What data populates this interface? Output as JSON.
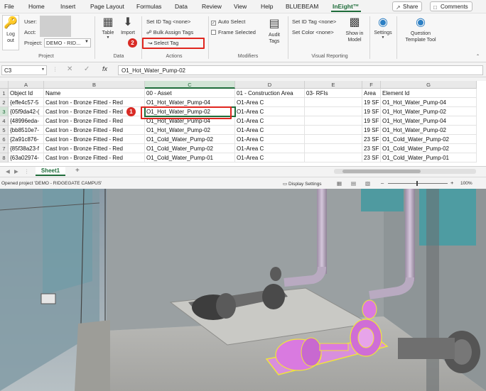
{
  "menu": {
    "file": "File",
    "home": "Home",
    "insert": "Insert",
    "page_layout": "Page Layout",
    "formulas": "Formulas",
    "data": "Data",
    "review": "Review",
    "view": "View",
    "help": "Help",
    "bluebeam": "BLUEBEAM",
    "ineight": "InEight™",
    "share": "Share",
    "comments": "Comments"
  },
  "ribbon": {
    "project": {
      "logout": "Log\nout",
      "user": "User:",
      "account": "Acct:",
      "project": "Project:",
      "project_value": "DEMO - RID...",
      "group": "Project"
    },
    "data": {
      "table": "Table",
      "import": "Import",
      "group": "Data"
    },
    "actions": {
      "set_id_tag": "Set ID Tag  <none>",
      "bulk_assign_tags": "Bulk Assign Tags",
      "select_tag": "Select Tag",
      "group": "Actions"
    },
    "modifiers": {
      "auto_select": "Auto Select",
      "frame_selected": "Frame Selected",
      "audit_tags": "Audit\nTags",
      "group": "Modifiers"
    },
    "visual": {
      "set_id_tag": "Set ID Tag  <none>",
      "set_color": "Set Color  <none>",
      "show_in_model": "Show in\nModel",
      "group": "Visual Reporting"
    },
    "settings": "Settings",
    "question_template_tool": "Question\nTemplate Tool"
  },
  "formula": {
    "name_box": "C3",
    "fx": "fx",
    "value": "O1_Hot_Water_Pump-02"
  },
  "grid": {
    "columns": [
      {
        "letter": "A",
        "w": 50
      },
      {
        "letter": "B",
        "w": 142
      },
      {
        "letter": "C",
        "w": 127
      },
      {
        "letter": "D",
        "w": 98
      },
      {
        "letter": "E",
        "w": 81
      },
      {
        "letter": "F",
        "w": 26
      },
      {
        "letter": "G",
        "w": 135
      }
    ],
    "rows": [
      [
        "Object Id",
        "Name",
        "00 - Asset",
        "01 - Construction Area",
        "03- RFIs",
        "Area",
        "Element Id"
      ],
      [
        "{effe4c57-5",
        "Cast Iron - Bronze Fitted - Red",
        "O1_Hot_Water_Pump-04",
        "O1-Area C",
        "",
        "19 SF",
        "O1_Hot_Water_Pump-04"
      ],
      [
        "{05f9da42-(",
        "Cast Iron - Bronze Fitted - Red",
        "O1_Hot_Water_Pump-02",
        "O1-Area C",
        "",
        "19 SF",
        "O1_Hot_Water_Pump-02"
      ],
      [
        "{48996eda-",
        "Cast Iron - Bronze Fitted - Red",
        "O1_Hot_Water_Pump-04",
        "O1-Area C",
        "",
        "19 SF",
        "O1_Hot_Water_Pump-04"
      ],
      [
        "{bb8510e7-",
        "Cast Iron - Bronze Fitted - Red",
        "O1_Hot_Water_Pump-02",
        "O1-Area C",
        "",
        "19 SF",
        "O1_Hot_Water_Pump-02"
      ],
      [
        "{2a91c876-",
        "Cast Iron - Bronze Fitted - Red",
        "O1_Cold_Water_Pump-02",
        "O1-Area C",
        "",
        "23 SF",
        "O1_Cold_Water_Pump-02"
      ],
      [
        "{85f38a23-f",
        "Cast Iron - Bronze Fitted - Red",
        "O1_Cold_Water_Pump-02",
        "O1-Area C",
        "",
        "23 SF",
        "O1_Cold_Water_Pump-02"
      ],
      [
        "{63a02974-",
        "Cast Iron - Bronze Fitted - Red",
        "O1_Cold_Water_Pump-01",
        "O1-Area C",
        "",
        "23 SF",
        "O1_Cold_Water_Pump-01"
      ]
    ]
  },
  "sheet": {
    "tab": "Sheet1",
    "add": "+"
  },
  "status": {
    "message": "Opened project 'DEMO - RIDGEGATE CAMPUS'",
    "display_settings": "Display Settings",
    "zoom": "100%"
  },
  "callouts": {
    "one": "1",
    "two": "2"
  },
  "colors": {
    "accent": "#1e6c3a",
    "highlight": "#e0261f",
    "selected_model": "#d97ae0"
  }
}
